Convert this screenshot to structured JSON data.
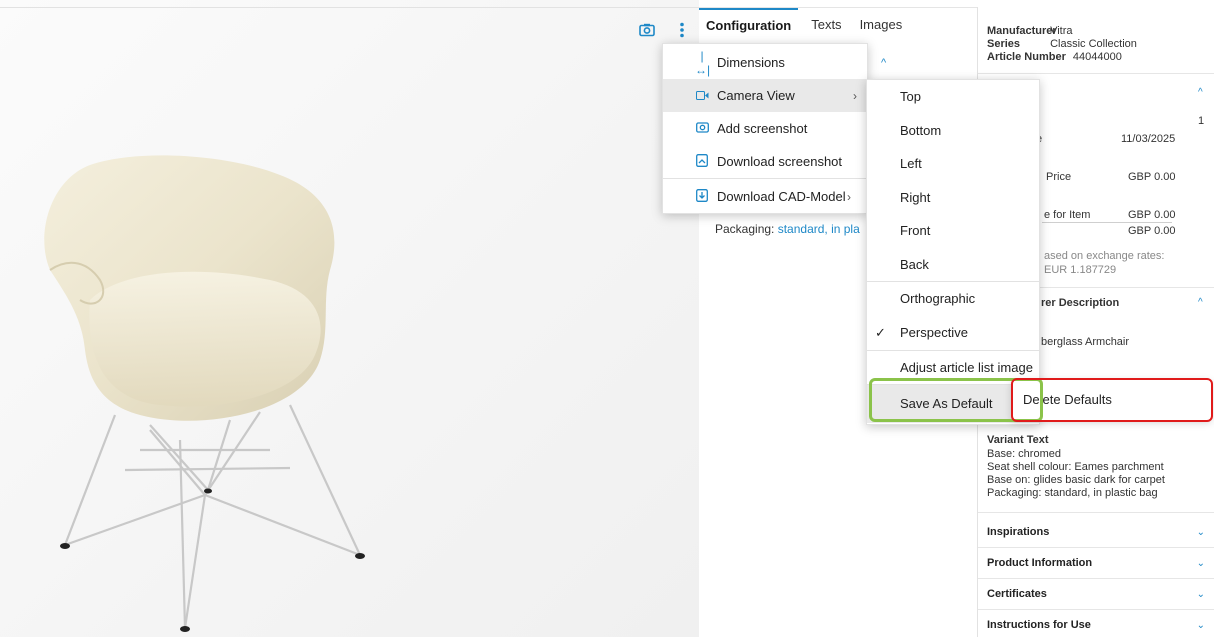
{
  "tabs": [
    "Configuration",
    "Texts",
    "Images"
  ],
  "menu": {
    "items": [
      {
        "label": "Dimensions",
        "icon": "dimensions-icon"
      },
      {
        "label": "Camera View",
        "icon": "camera-view-icon"
      },
      {
        "label": "Add screenshot",
        "icon": "camera-icon"
      },
      {
        "label": "Download screenshot",
        "icon": "download-image-icon"
      },
      {
        "label": "Download CAD-Model",
        "icon": "download-file-icon"
      }
    ]
  },
  "camera_submenu": {
    "items": [
      "Top",
      "Bottom",
      "Left",
      "Right",
      "Front",
      "Back",
      "Orthographic",
      "Perspective",
      "Adjust article list image",
      "Save As Default"
    ]
  },
  "delete_defaults": "Delete Defaults",
  "packaging": {
    "label": "Packaging:",
    "value": "standard, in pla"
  },
  "right": {
    "manufacturer_label": "Manufacturer",
    "manufacturer": "Vitra",
    "series_label": "Series",
    "series": "Classic Collection",
    "article_label": "Article Number",
    "article": "44044000",
    "qty": "1",
    "date_label": "e",
    "date": "11/03/2025",
    "price_label": "Price",
    "price": "GBP 0.00",
    "item_label": "e for Item",
    "item_price": "GBP 0.00",
    "total": "GBP 0.00",
    "exchange1": "ased on exchange rates:",
    "exchange2": "EUR 1.187729",
    "desc_section": "rer Description",
    "desc_text": "berglass Armchair",
    "variant_title": "Variant Text",
    "variant_lines": [
      "Base: chromed",
      "Seat shell colour: Eames parchment",
      "Base on: glides basic dark for carpet",
      "Packaging: standard, in plastic bag"
    ],
    "sections": [
      "Inspirations",
      "Product Information",
      "Certificates",
      "Instructions for Use"
    ]
  }
}
